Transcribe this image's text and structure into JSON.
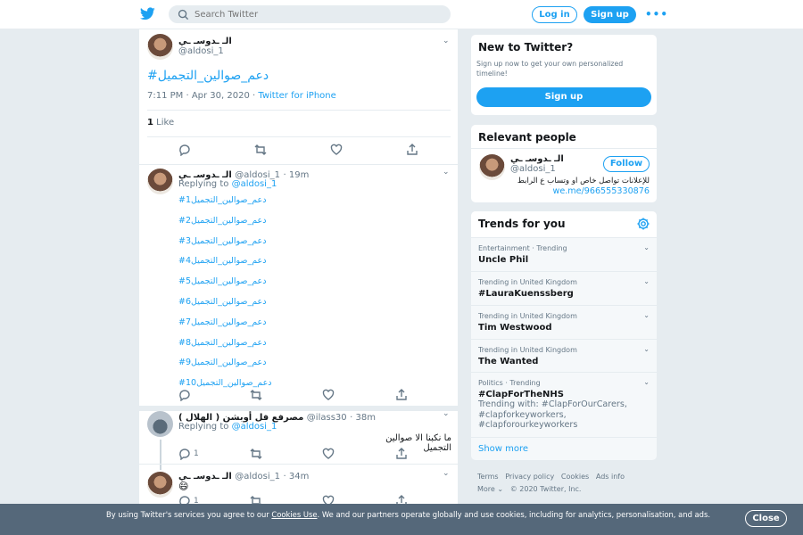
{
  "topbar": {
    "search_placeholder": "Search Twitter",
    "login_label": "Log in",
    "signup_label": "Sign up",
    "more_label": "•••"
  },
  "main_tweet": {
    "name": "الـ ـدوسـ ـي",
    "handle": "@aldosi_1",
    "hashtag": "#دعم_صوالين_التجميل",
    "timestamp": "7:11 PM · Apr 30, 2020",
    "source": "Twitter for iPhone",
    "likes_count": "1",
    "likes_label": "Like"
  },
  "replies": [
    {
      "name": "الـ ـدوسـ ـي",
      "handle": "@aldosi_1",
      "time": "· 19m",
      "replying_label": "Replying to",
      "replying_handle": "@aldosi_1",
      "lines": [
        "#دعم_صوالين_التجميل1",
        "#دعم_صوالين_التجميل2",
        "#دعم_صوالين_التجميل3",
        "#دعم_صوالين_التجميل4",
        "#دعم_صوالين_التجميل5",
        "#دعم_صوالين_التجميل6",
        "#دعم_صوالين_التجميل7",
        "#دعم_صوالين_التجميل8",
        "#دعم_صوالين_التجميل9",
        "#دعم_صوالين_التجميل10"
      ]
    },
    {
      "name": "مصرفع فل أوبشن ( الهلال )",
      "handle": "@ilass30",
      "time": "· 38m",
      "replying_label": "Replying to",
      "replying_handle": "@aldosi_1",
      "text": "ما نكبنا الا صوالين التجميل",
      "reply_count": "1",
      "retweet_count": "",
      "like_count": ""
    },
    {
      "name": "الـ ـدوسـ ـي",
      "handle": "@aldosi_1",
      "time": "· 34m",
      "text": "😄",
      "reply_count": "1"
    }
  ],
  "new_to_twitter": {
    "title": "New to Twitter?",
    "description": "Sign up now to get your own personalized timeline!",
    "signup_label": "Sign up"
  },
  "relevant_people": {
    "title": "Relevant people",
    "name": "الـ ـدوسـ ـي",
    "handle": "@aldosi_1",
    "follow_label": "Follow",
    "bio": "للإعلانات تواصل خاص او وتساب ع الرابط",
    "bio_link": "we.me/966555330876"
  },
  "trends": {
    "title": "Trends for you",
    "items": [
      {
        "meta": "Entertainment · Trending",
        "name": "Uncle Phil"
      },
      {
        "meta": "Trending in United Kingdom",
        "name": "#LauraKuenssberg"
      },
      {
        "meta": "Trending in United Kingdom",
        "name": "Tim Westwood"
      },
      {
        "meta": "Trending in United Kingdom",
        "name": "The Wanted"
      },
      {
        "meta": "Politics · Trending",
        "name": "#ClapForTheNHS",
        "with": "Trending with: #ClapForOurCarers, #clapforkeyworkers, #clapforourkeyworkers"
      }
    ],
    "show_more": "Show more"
  },
  "footer": {
    "links": [
      "Terms",
      "Privacy policy",
      "Cookies",
      "Ads info"
    ],
    "more_label": "More",
    "copyright": "© 2020 Twitter, Inc."
  },
  "cookie_banner": {
    "text_before": "By using Twitter's services you agree to our ",
    "link": "Cookies Use",
    "text_after": ". We and our partners operate globally and use cookies, including for analytics, personalisation, and ads.",
    "close_label": "Close"
  },
  "colors": {
    "accent": "#1da1f2",
    "background": "#e6ecf0",
    "banner": "#55687a"
  }
}
